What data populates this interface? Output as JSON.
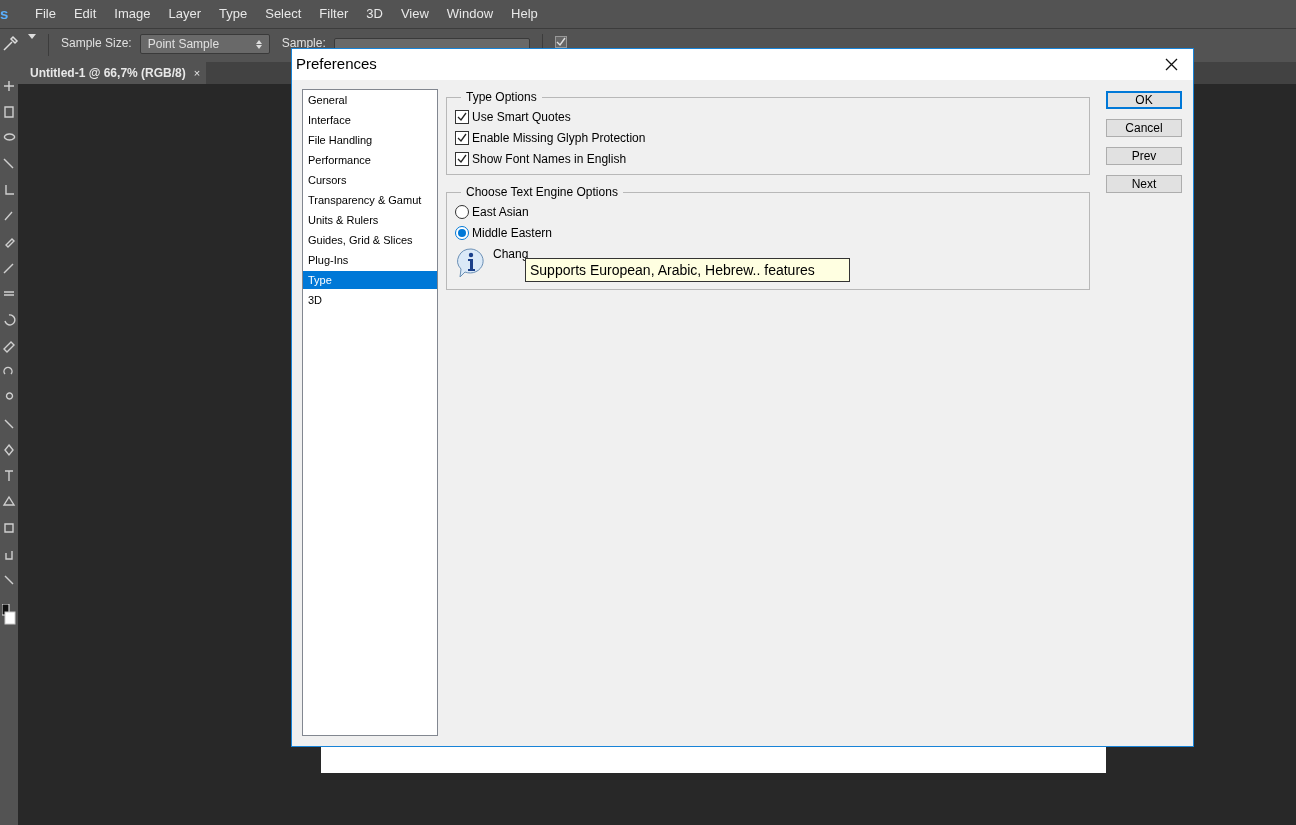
{
  "app": {
    "logo": "s"
  },
  "menu": [
    "File",
    "Edit",
    "Image",
    "Layer",
    "Type",
    "Select",
    "Filter",
    "3D",
    "View",
    "Window",
    "Help"
  ],
  "options_bar": {
    "sample_size_label": "Sample Size:",
    "sample_size": "Point Sample",
    "sample_label": "Sample:",
    "show_ring": {
      "checked": true
    }
  },
  "document_tab": {
    "title": "Untitled-1 @ 66,7% (RGB/8)",
    "close": "×"
  },
  "dialog": {
    "title": "Preferences",
    "sidebar": [
      {
        "label": "General",
        "selected": false
      },
      {
        "label": "Interface",
        "selected": false
      },
      {
        "label": "File Handling",
        "selected": false
      },
      {
        "label": "Performance",
        "selected": false
      },
      {
        "label": "Cursors",
        "selected": false
      },
      {
        "label": "Transparency & Gamut",
        "selected": false
      },
      {
        "label": "Units & Rulers",
        "selected": false
      },
      {
        "label": "Guides, Grid & Slices",
        "selected": false
      },
      {
        "label": "Plug-Ins",
        "selected": false
      },
      {
        "label": "Type",
        "selected": true
      },
      {
        "label": "3D",
        "selected": false
      }
    ],
    "type_options": {
      "title": "Type Options",
      "items": [
        {
          "label": "Use Smart Quotes",
          "checked": true
        },
        {
          "label": "Enable Missing Glyph Protection",
          "checked": true
        },
        {
          "label": "Show Font Names in English",
          "checked": true
        }
      ]
    },
    "text_engine": {
      "title": "Choose Text Engine Options",
      "options": [
        {
          "label": "East Asian",
          "selected": false
        },
        {
          "label": "Middle Eastern",
          "selected": true
        }
      ],
      "note": "Chang"
    },
    "tooltip": "Supports European, Arabic, Hebrew.. features",
    "buttons": [
      {
        "label": "OK",
        "default": true
      },
      {
        "label": "Cancel",
        "default": false
      },
      {
        "label": "Prev",
        "default": false
      },
      {
        "label": "Next",
        "default": false
      }
    ]
  }
}
